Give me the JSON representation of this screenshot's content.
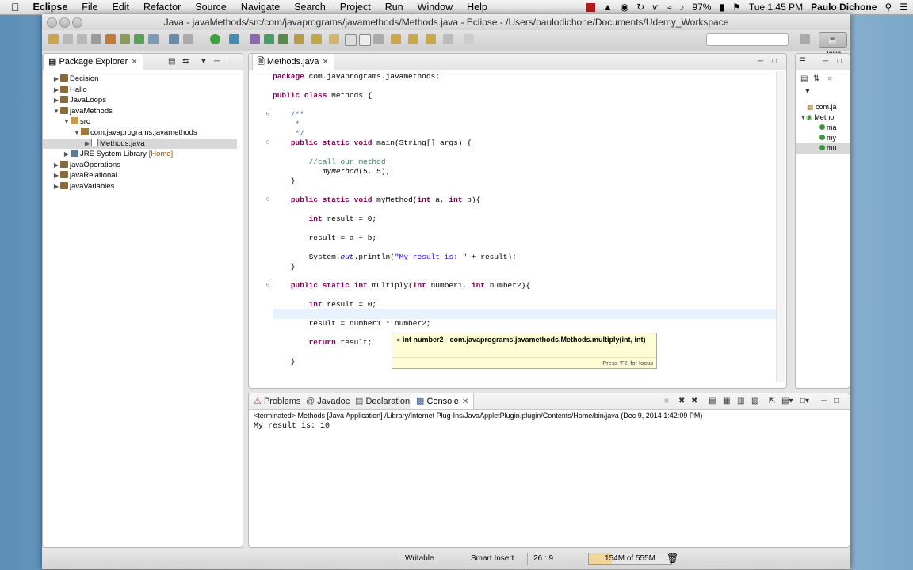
{
  "menubar": {
    "app_name": "Eclipse",
    "items": [
      "File",
      "Edit",
      "Refactor",
      "Source",
      "Navigate",
      "Search",
      "Project",
      "Run",
      "Window",
      "Help"
    ],
    "battery": "97%",
    "clock": "Tue 1:45 PM",
    "user": "Paulo Dichone"
  },
  "window": {
    "title": "Java - javaMethods/src/com/javaprograms/javamethods/Methods.java - Eclipse - /Users/paulodichone/Documents/Udemy_Workspace",
    "perspective": "Java"
  },
  "package_explorer": {
    "tab": "Package Explorer",
    "rows": [
      {
        "label": "Decision",
        "extra": ""
      },
      {
        "label": "Hallo",
        "extra": ""
      },
      {
        "label": "JavaLoops",
        "extra": ""
      },
      {
        "label": "javaMethods",
        "extra": ""
      },
      {
        "label": "src",
        "extra": ""
      },
      {
        "label": "com.javaprograms.javamethods",
        "extra": ""
      },
      {
        "label": "Methods.java",
        "extra": ""
      },
      {
        "label": "JRE System Library",
        "extra": "[Home]"
      },
      {
        "label": "javaOperations",
        "extra": ""
      },
      {
        "label": "javaRelational",
        "extra": ""
      },
      {
        "label": "javaVariables",
        "extra": ""
      }
    ]
  },
  "editor": {
    "tab": "Methods.java",
    "hover": {
      "signature": "int number2 - com.javaprograms.javamethods.Methods.multiply(int, int)",
      "hint": "Press 'F2' for focus"
    }
  },
  "outline": {
    "rows": [
      "com.ja",
      "Metho",
      "ma",
      "my",
      "mu"
    ]
  },
  "console": {
    "tabs": [
      "Problems",
      "Javadoc",
      "Declaration",
      "Console"
    ],
    "active_tab": "Console",
    "header": "<terminated> Methods [Java Application] /Library/Internet Plug-Ins/JavaAppletPlugin.plugin/Contents/Home/bin/java (Dec 9, 2014 1:42:09 PM)",
    "output": "My result is: 10"
  },
  "statusbar": {
    "writable": "Writable",
    "insert_mode": "Smart Insert",
    "position": "26 : 9",
    "heap": "154M of 555M",
    "heap_used_fraction": 0.277
  }
}
